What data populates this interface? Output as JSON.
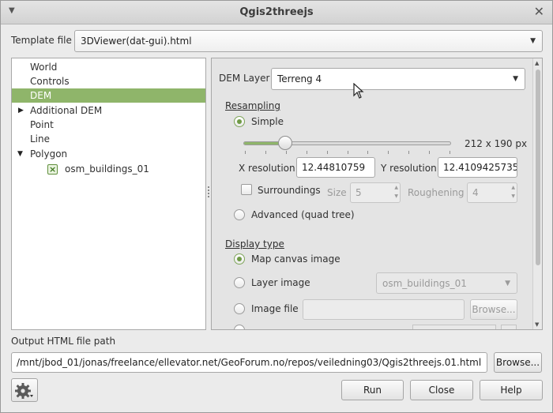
{
  "window": {
    "title": "Qgis2threejs"
  },
  "template": {
    "label": "Template file",
    "value": "3DViewer(dat-gui).html"
  },
  "tree": {
    "items": [
      {
        "label": "World"
      },
      {
        "label": "Controls"
      },
      {
        "label": "DEM",
        "selected": true
      },
      {
        "label": "Additional DEM",
        "expander": "collapsed"
      },
      {
        "label": "Point"
      },
      {
        "label": "Line"
      },
      {
        "label": "Polygon",
        "expander": "expanded"
      },
      {
        "label": "osm_buildings_01",
        "checked": true
      }
    ]
  },
  "dem": {
    "layer_label": "DEM Layer",
    "layer_value": "Terreng 4",
    "resampling": {
      "title": "Resampling",
      "simple_label": "Simple",
      "simple_selected": true,
      "slider_fraction": 0.2,
      "size_text": "212 x 190 px",
      "x_label": "X resolution",
      "x_value": "12.44810759",
      "y_label": "Y resolution",
      "y_value": "12.4109425735",
      "surroundings_label": "Surroundings",
      "size_label": "Size",
      "size_value": "5",
      "roughening_label": "Roughening",
      "roughening_value": "4",
      "advanced_label": "Advanced (quad tree)"
    },
    "display": {
      "title": "Display type",
      "map_canvas_label": "Map canvas image",
      "layer_image_label": "Layer image",
      "layer_image_value": "osm_buildings_01",
      "image_file_label": "Image file",
      "browse_label": "Browse..."
    }
  },
  "output": {
    "label": "Output HTML file path",
    "path": "/mnt/jbod_01/jonas/freelance/ellevator.net/GeoForum.no/repos/veiledning03/Qgis2threejs.01.html",
    "browse_label": "Browse..."
  },
  "buttons": {
    "run": "Run",
    "close": "Close",
    "help": "Help"
  },
  "colors": {
    "selection": "#8fb56a",
    "accent": "#6f9a46"
  }
}
